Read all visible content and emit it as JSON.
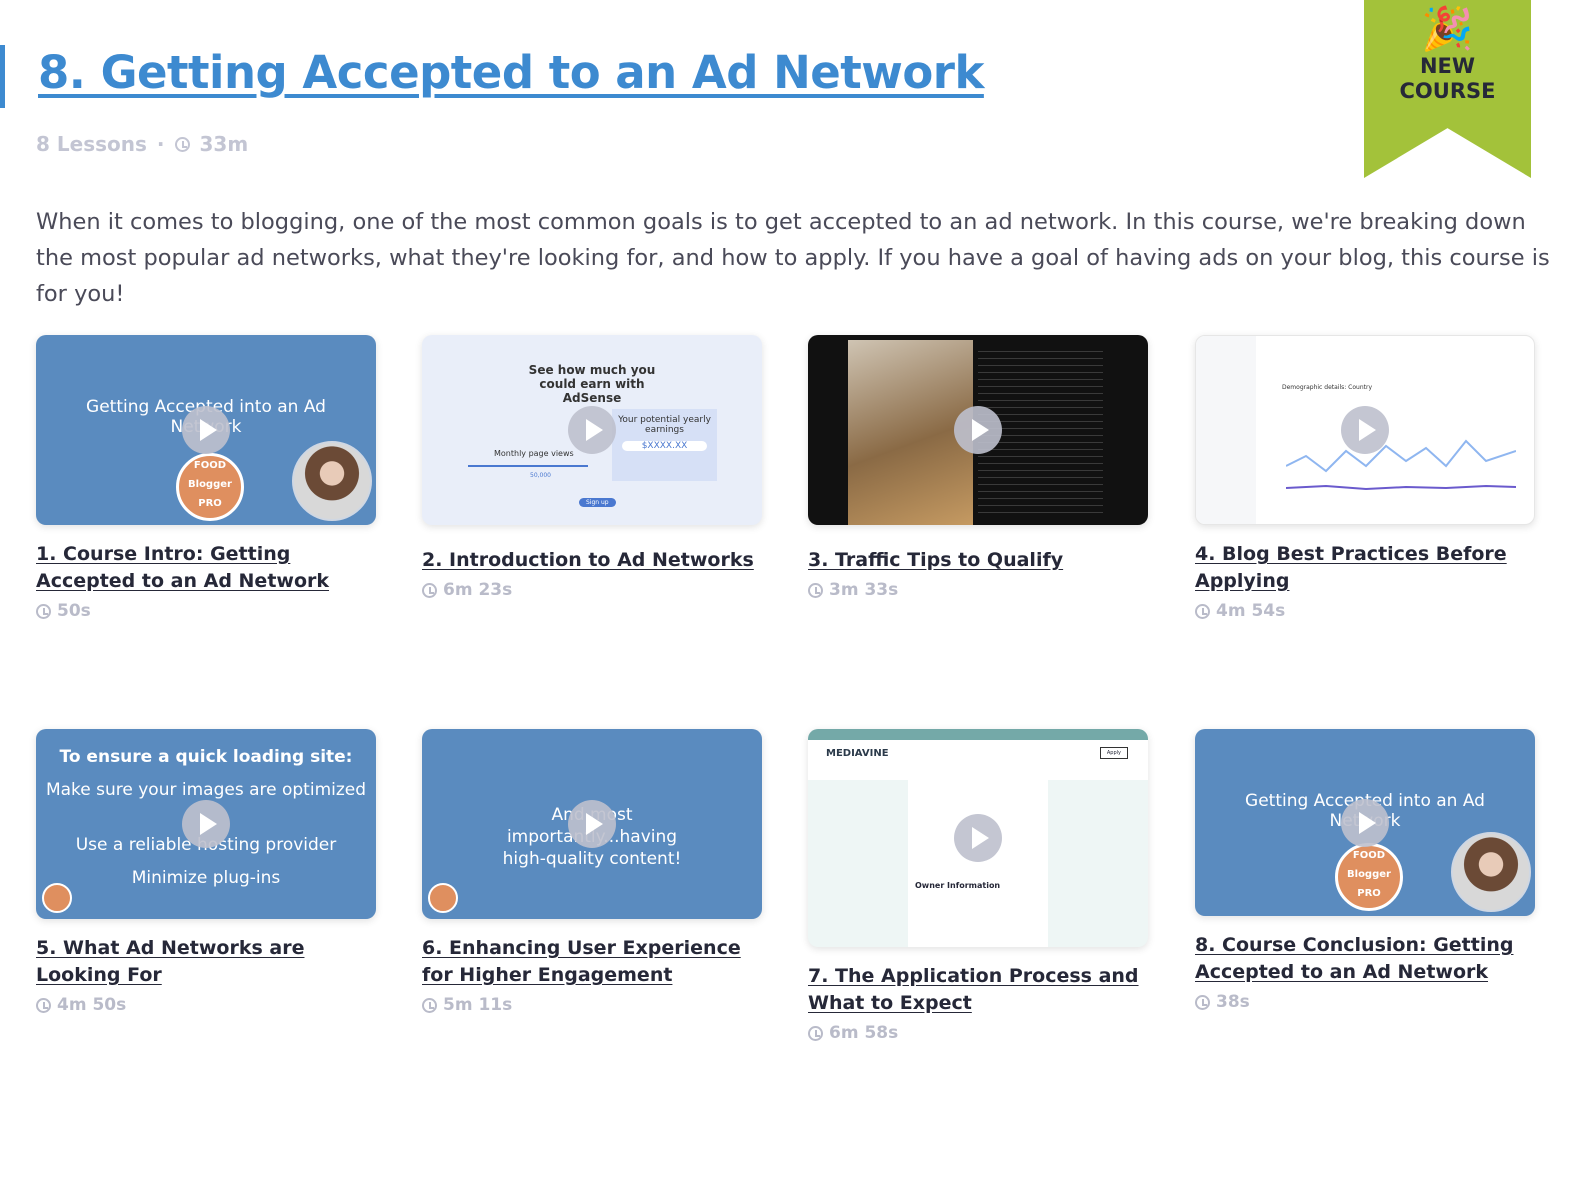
{
  "course": {
    "title": "8. Getting Accepted to an Ad Network",
    "lessons": "8 Lessons",
    "separator": "·",
    "duration": "33m",
    "badge": {
      "emoji": "🎉",
      "line1": "NEW",
      "line2": "COURSE",
      "color": "#a3c23a"
    },
    "description": "When it comes to blogging, one of the most common goals is to get accepted to an ad network. In this course, we're breaking down the most popular ad networks, what they're looking for, and how to apply. If you have a goal of having ads on your blog, this course is for you!",
    "accent": "#3d8ad0"
  },
  "lessons": [
    {
      "title": "1. Course Intro: Getting Accepted to an Ad Network",
      "duration": "50s",
      "thumb_text": "Getting Accepted into an Ad Network",
      "logo": [
        "FOOD",
        "Blogger",
        "PRO"
      ]
    },
    {
      "title": "2. Introduction to Ad Networks",
      "duration": "6m 23s",
      "thumb_heading": "See how much you could earn with AdSense",
      "thumb_box": "Your potential yearly earnings",
      "thumb_amount": "$XXXX.XX",
      "thumb_slider": "Monthly page views",
      "thumb_value": "50,000",
      "thumb_button": "Sign up"
    },
    {
      "title": "3. Traffic Tips to Qualify",
      "duration": "3m 33s"
    },
    {
      "title": "4. Blog Best Practices Before Applying",
      "duration": "4m 54s",
      "thumb_label": "Demographic details: Country"
    },
    {
      "title": "5. What Ad Networks are Looking For",
      "duration": "4m 50s",
      "thumb_heading": "To ensure a quick loading site:",
      "thumb_bullets": [
        "Make sure your images are optimized",
        "Use a reliable hosting provider",
        "Minimize plug-ins"
      ]
    },
    {
      "title": "6. Enhancing User Experience for Higher Engagement",
      "duration": "5m 11s",
      "thumb_text": "And most importantly...having high-quality content!"
    },
    {
      "title": "7. The Application Process and What to Expect",
      "duration": "6m 58s",
      "thumb_brand": "MEDIAVINE",
      "thumb_section": "Owner Information",
      "thumb_apply": "Apply"
    },
    {
      "title": "8. Course Conclusion: Getting Accepted to an Ad Network",
      "duration": "38s",
      "thumb_text": "Getting Accepted into an Ad Network",
      "logo": [
        "FOOD",
        "Blogger",
        "PRO"
      ]
    }
  ]
}
